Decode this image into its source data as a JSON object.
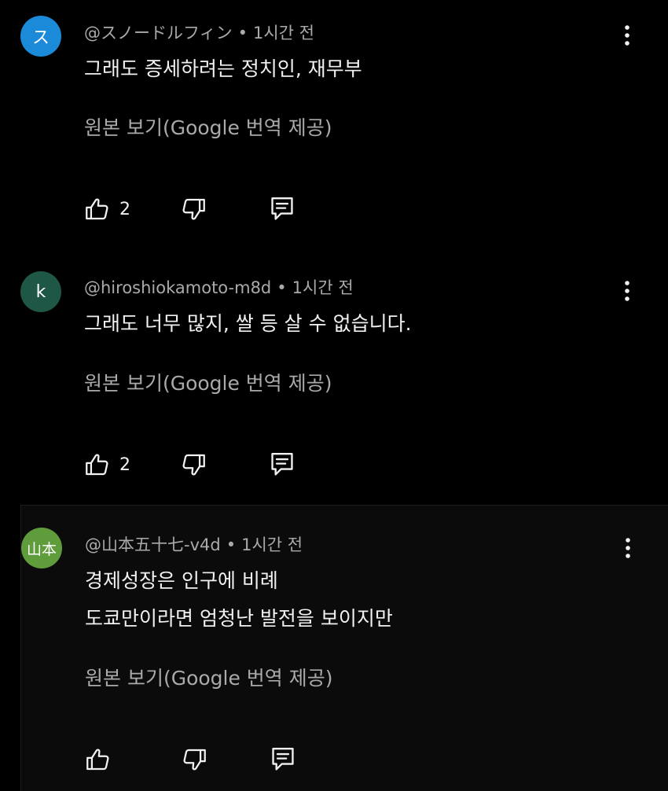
{
  "comments": [
    {
      "avatar_letter": "ス",
      "avatar_color": "#1a8ad9",
      "author": "@スノードルフィン",
      "separator": "•",
      "time": "1시간 전",
      "lines": [
        "그래도 증세하려는 정치인, 재무부"
      ],
      "translate_label": "원본 보기(Google 번역 제공)",
      "likes": "2"
    },
    {
      "avatar_letter": "k",
      "avatar_color": "#1e5745",
      "author": "@hiroshiokamoto-m8d",
      "separator": "•",
      "time": "1시간 전",
      "lines": [
        "그래도 너무 많지, 쌀 등 살 수 없습니다."
      ],
      "translate_label": "원본 보기(Google 번역 제공)",
      "likes": "2"
    },
    {
      "avatar_letter": "山本",
      "avatar_color": "#5f9c3b",
      "author": "@山本五十七-v4d",
      "separator": "•",
      "time": "1시간 전",
      "lines": [
        "경제성장은 인구에 비례",
        "도쿄만이라면 엄청난 발전을 보이지만"
      ],
      "translate_label": "원본 보기(Google 번역 제공)",
      "likes": ""
    }
  ],
  "icons": {
    "like": "thumb-up-icon",
    "dislike": "thumb-down-icon",
    "reply": "reply-icon",
    "more": "more-vertical-icon"
  }
}
